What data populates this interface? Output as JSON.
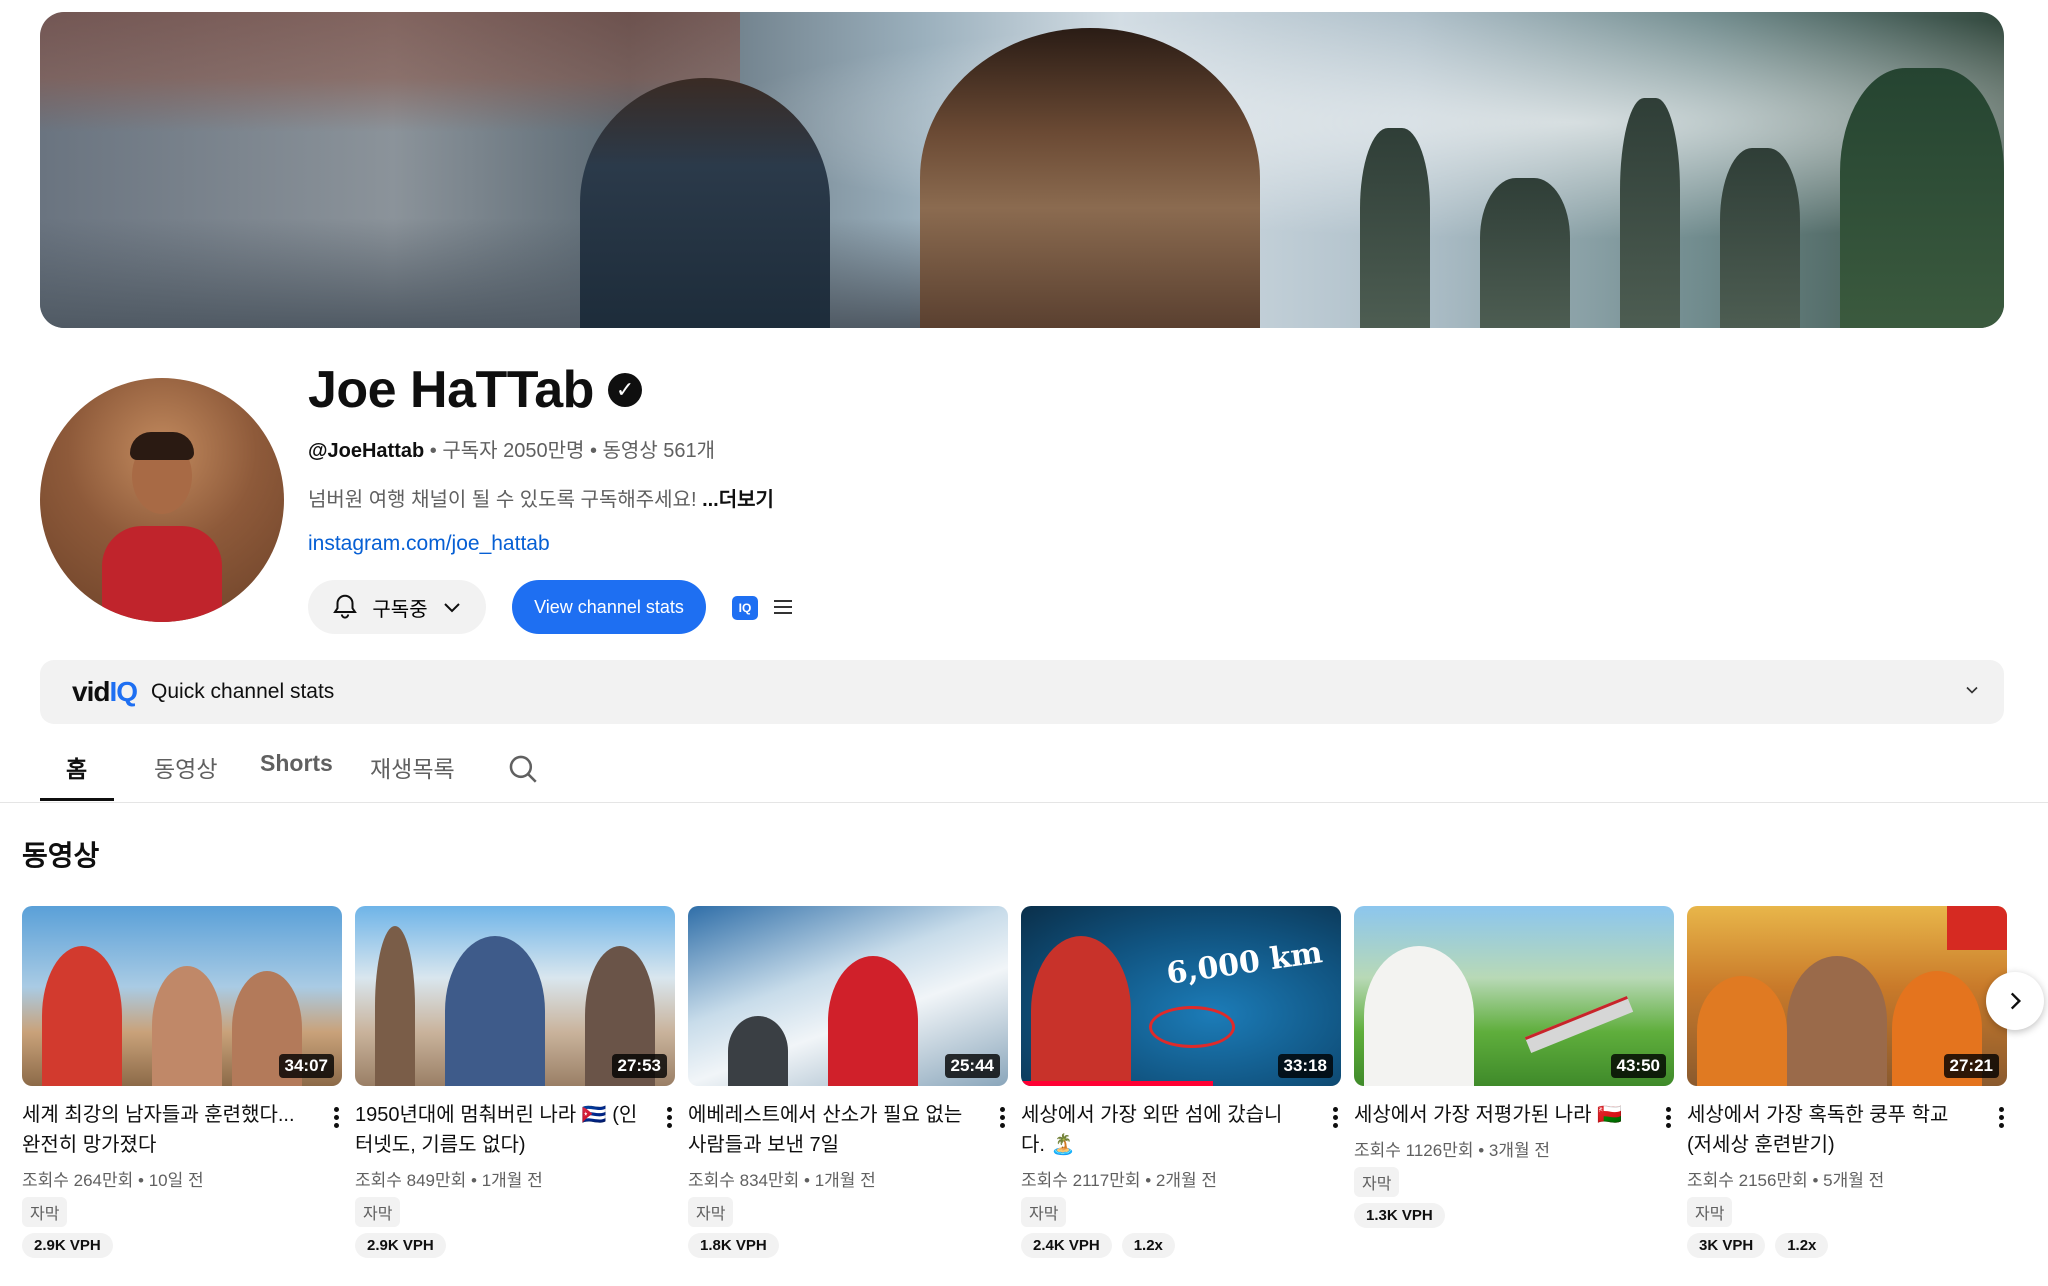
{
  "channel": {
    "name": "Joe HaTTab",
    "handle": "@JoeHattab",
    "subscribers": "구독자 2050만명",
    "videos_count": "동영상 561개",
    "separator": " • ",
    "description": "넘버원 여행 채널이 될 수 있도록 구독해주세요! ",
    "more_label": "...더보기",
    "link": "instagram.com/joe_hattab"
  },
  "actions": {
    "subscribe_label": "구독중",
    "stats_label": "View channel stats",
    "iq_label": "IQ"
  },
  "vidiq": {
    "logo_vid": "vid",
    "logo_iq": "IQ",
    "title": "Quick channel stats"
  },
  "tabs": [
    {
      "label": "홈"
    },
    {
      "label": "동영상"
    },
    {
      "label": "Shorts"
    },
    {
      "label": "재생목록"
    }
  ],
  "section_title": "동영상",
  "videos": [
    {
      "title": "세계 최강의 남자들과 훈련했다... 완전히 망가졌다",
      "duration": "34:07",
      "views": "조회수 264만회",
      "age": "10일 전",
      "caption": "자막",
      "vph": "2.9K VPH",
      "multiplier": ""
    },
    {
      "title": "1950년대에 멈춰버린 나라 🇨🇺 (인터넷도, 기름도 없다)",
      "duration": "27:53",
      "views": "조회수 849만회",
      "age": "1개월 전",
      "caption": "자막",
      "vph": "2.9K VPH",
      "multiplier": ""
    },
    {
      "title": "에베레스트에서 산소가 필요 없는 사람들과 보낸 7일",
      "duration": "25:44",
      "views": "조회수 834만회",
      "age": "1개월 전",
      "caption": "자막",
      "vph": "1.8K VPH",
      "multiplier": ""
    },
    {
      "title": "세상에서 가장 외딴 섬에 갔습니다. 🏝️",
      "duration": "33:18",
      "views": "조회수 2117만회",
      "age": "2개월 전",
      "caption": "자막",
      "vph": "2.4K VPH",
      "multiplier": "1.2x",
      "overlay_text": "6,000 km",
      "progress": 0.6
    },
    {
      "title": "세상에서 가장 저평가된 나라 🇴🇲",
      "duration": "43:50",
      "views": "조회수 1126만회",
      "age": "3개월 전",
      "caption": "자막",
      "vph": "1.3K VPH",
      "multiplier": ""
    },
    {
      "title": "세상에서 가장 혹독한 쿵푸 학교 (저세상 훈련받기)",
      "duration": "27:21",
      "views": "조회수 2156만회",
      "age": "5개월 전",
      "caption": "자막",
      "vph": "3K VPH",
      "multiplier": "1.2x"
    }
  ],
  "colors": {
    "accent": "#1e6ff2",
    "link": "#065fd4",
    "progress": "#ff0033"
  }
}
